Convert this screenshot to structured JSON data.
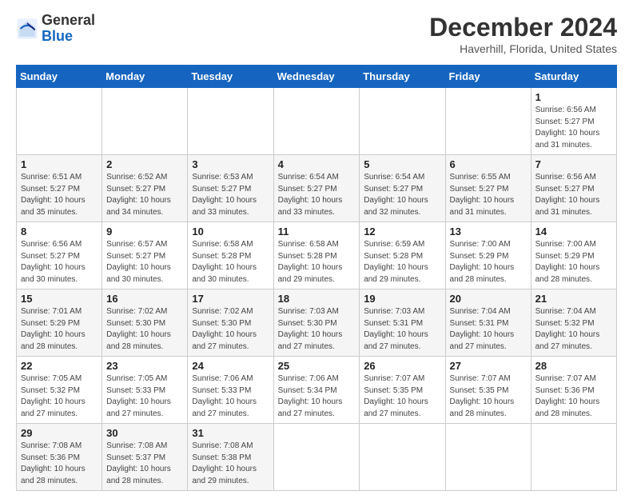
{
  "header": {
    "logo": {
      "general": "General",
      "blue": "Blue"
    },
    "title": "December 2024",
    "location": "Haverhill, Florida, United States"
  },
  "calendar": {
    "days_of_week": [
      "Sunday",
      "Monday",
      "Tuesday",
      "Wednesday",
      "Thursday",
      "Friday",
      "Saturday"
    ],
    "weeks": [
      [
        null,
        null,
        null,
        null,
        null,
        null,
        null
      ]
    ],
    "cells": [
      {
        "day": null,
        "week": 0,
        "col": 0
      },
      {
        "day": null,
        "week": 0,
        "col": 1
      },
      {
        "day": null,
        "week": 0,
        "col": 2
      },
      {
        "day": null,
        "week": 0,
        "col": 3
      },
      {
        "day": null,
        "week": 0,
        "col": 4
      },
      {
        "day": null,
        "week": 0,
        "col": 5
      },
      {
        "day": null,
        "week": 0,
        "col": 6
      }
    ]
  },
  "rows": [
    [
      {
        "num": null,
        "sunrise": null,
        "sunset": null,
        "daylight": null
      },
      {
        "num": null,
        "sunrise": null,
        "sunset": null,
        "daylight": null
      },
      {
        "num": null,
        "sunrise": null,
        "sunset": null,
        "daylight": null
      },
      {
        "num": null,
        "sunrise": null,
        "sunset": null,
        "daylight": null
      },
      {
        "num": null,
        "sunrise": null,
        "sunset": null,
        "daylight": null
      },
      {
        "num": null,
        "sunrise": null,
        "sunset": null,
        "daylight": null
      },
      {
        "num": "1",
        "sunrise": "Sunrise: 6:56 AM",
        "sunset": "Sunset: 5:27 PM",
        "daylight": "Daylight: 10 hours and 31 minutes."
      }
    ],
    [
      {
        "num": "1",
        "sunrise": "Sunrise: 6:51 AM",
        "sunset": "Sunset: 5:27 PM",
        "daylight": "Daylight: 10 hours and 35 minutes."
      },
      {
        "num": "2",
        "sunrise": "Sunrise: 6:52 AM",
        "sunset": "Sunset: 5:27 PM",
        "daylight": "Daylight: 10 hours and 34 minutes."
      },
      {
        "num": "3",
        "sunrise": "Sunrise: 6:53 AM",
        "sunset": "Sunset: 5:27 PM",
        "daylight": "Daylight: 10 hours and 33 minutes."
      },
      {
        "num": "4",
        "sunrise": "Sunrise: 6:54 AM",
        "sunset": "Sunset: 5:27 PM",
        "daylight": "Daylight: 10 hours and 33 minutes."
      },
      {
        "num": "5",
        "sunrise": "Sunrise: 6:54 AM",
        "sunset": "Sunset: 5:27 PM",
        "daylight": "Daylight: 10 hours and 32 minutes."
      },
      {
        "num": "6",
        "sunrise": "Sunrise: 6:55 AM",
        "sunset": "Sunset: 5:27 PM",
        "daylight": "Daylight: 10 hours and 31 minutes."
      },
      {
        "num": "7",
        "sunrise": "Sunrise: 6:56 AM",
        "sunset": "Sunset: 5:27 PM",
        "daylight": "Daylight: 10 hours and 31 minutes."
      }
    ],
    [
      {
        "num": "8",
        "sunrise": "Sunrise: 6:56 AM",
        "sunset": "Sunset: 5:27 PM",
        "daylight": "Daylight: 10 hours and 30 minutes."
      },
      {
        "num": "9",
        "sunrise": "Sunrise: 6:57 AM",
        "sunset": "Sunset: 5:27 PM",
        "daylight": "Daylight: 10 hours and 30 minutes."
      },
      {
        "num": "10",
        "sunrise": "Sunrise: 6:58 AM",
        "sunset": "Sunset: 5:28 PM",
        "daylight": "Daylight: 10 hours and 30 minutes."
      },
      {
        "num": "11",
        "sunrise": "Sunrise: 6:58 AM",
        "sunset": "Sunset: 5:28 PM",
        "daylight": "Daylight: 10 hours and 29 minutes."
      },
      {
        "num": "12",
        "sunrise": "Sunrise: 6:59 AM",
        "sunset": "Sunset: 5:28 PM",
        "daylight": "Daylight: 10 hours and 29 minutes."
      },
      {
        "num": "13",
        "sunrise": "Sunrise: 7:00 AM",
        "sunset": "Sunset: 5:29 PM",
        "daylight": "Daylight: 10 hours and 28 minutes."
      },
      {
        "num": "14",
        "sunrise": "Sunrise: 7:00 AM",
        "sunset": "Sunset: 5:29 PM",
        "daylight": "Daylight: 10 hours and 28 minutes."
      }
    ],
    [
      {
        "num": "15",
        "sunrise": "Sunrise: 7:01 AM",
        "sunset": "Sunset: 5:29 PM",
        "daylight": "Daylight: 10 hours and 28 minutes."
      },
      {
        "num": "16",
        "sunrise": "Sunrise: 7:02 AM",
        "sunset": "Sunset: 5:30 PM",
        "daylight": "Daylight: 10 hours and 28 minutes."
      },
      {
        "num": "17",
        "sunrise": "Sunrise: 7:02 AM",
        "sunset": "Sunset: 5:30 PM",
        "daylight": "Daylight: 10 hours and 27 minutes."
      },
      {
        "num": "18",
        "sunrise": "Sunrise: 7:03 AM",
        "sunset": "Sunset: 5:30 PM",
        "daylight": "Daylight: 10 hours and 27 minutes."
      },
      {
        "num": "19",
        "sunrise": "Sunrise: 7:03 AM",
        "sunset": "Sunset: 5:31 PM",
        "daylight": "Daylight: 10 hours and 27 minutes."
      },
      {
        "num": "20",
        "sunrise": "Sunrise: 7:04 AM",
        "sunset": "Sunset: 5:31 PM",
        "daylight": "Daylight: 10 hours and 27 minutes."
      },
      {
        "num": "21",
        "sunrise": "Sunrise: 7:04 AM",
        "sunset": "Sunset: 5:32 PM",
        "daylight": "Daylight: 10 hours and 27 minutes."
      }
    ],
    [
      {
        "num": "22",
        "sunrise": "Sunrise: 7:05 AM",
        "sunset": "Sunset: 5:32 PM",
        "daylight": "Daylight: 10 hours and 27 minutes."
      },
      {
        "num": "23",
        "sunrise": "Sunrise: 7:05 AM",
        "sunset": "Sunset: 5:33 PM",
        "daylight": "Daylight: 10 hours and 27 minutes."
      },
      {
        "num": "24",
        "sunrise": "Sunrise: 7:06 AM",
        "sunset": "Sunset: 5:33 PM",
        "daylight": "Daylight: 10 hours and 27 minutes."
      },
      {
        "num": "25",
        "sunrise": "Sunrise: 7:06 AM",
        "sunset": "Sunset: 5:34 PM",
        "daylight": "Daylight: 10 hours and 27 minutes."
      },
      {
        "num": "26",
        "sunrise": "Sunrise: 7:07 AM",
        "sunset": "Sunset: 5:35 PM",
        "daylight": "Daylight: 10 hours and 27 minutes."
      },
      {
        "num": "27",
        "sunrise": "Sunrise: 7:07 AM",
        "sunset": "Sunset: 5:35 PM",
        "daylight": "Daylight: 10 hours and 28 minutes."
      },
      {
        "num": "28",
        "sunrise": "Sunrise: 7:07 AM",
        "sunset": "Sunset: 5:36 PM",
        "daylight": "Daylight: 10 hours and 28 minutes."
      }
    ],
    [
      {
        "num": "29",
        "sunrise": "Sunrise: 7:08 AM",
        "sunset": "Sunset: 5:36 PM",
        "daylight": "Daylight: 10 hours and 28 minutes."
      },
      {
        "num": "30",
        "sunrise": "Sunrise: 7:08 AM",
        "sunset": "Sunset: 5:37 PM",
        "daylight": "Daylight: 10 hours and 28 minutes."
      },
      {
        "num": "31",
        "sunrise": "Sunrise: 7:08 AM",
        "sunset": "Sunset: 5:38 PM",
        "daylight": "Daylight: 10 hours and 29 minutes."
      },
      {
        "num": null,
        "sunrise": null,
        "sunset": null,
        "daylight": null
      },
      {
        "num": null,
        "sunrise": null,
        "sunset": null,
        "daylight": null
      },
      {
        "num": null,
        "sunrise": null,
        "sunset": null,
        "daylight": null
      },
      {
        "num": null,
        "sunrise": null,
        "sunset": null,
        "daylight": null
      }
    ]
  ],
  "dow_labels": {
    "0": "Sunday",
    "1": "Monday",
    "2": "Tuesday",
    "3": "Wednesday",
    "4": "Thursday",
    "5": "Friday",
    "6": "Saturday"
  }
}
